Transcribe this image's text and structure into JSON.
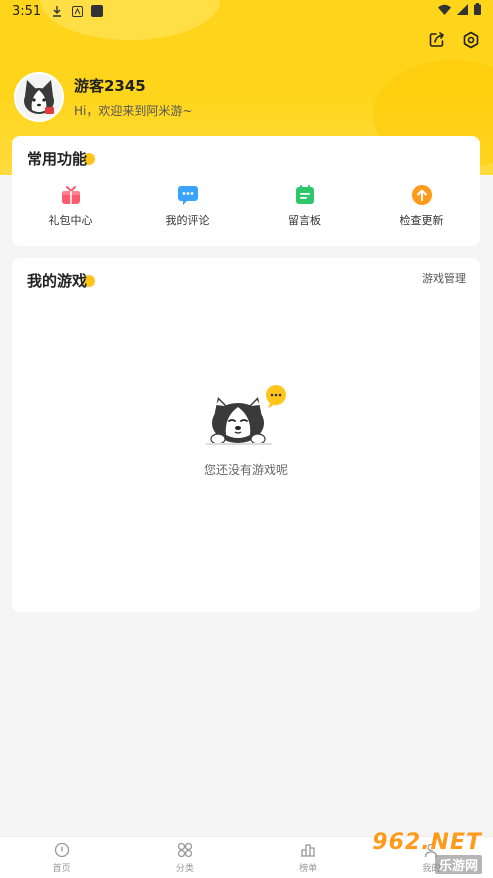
{
  "statusbar": {
    "time": "3:51"
  },
  "profile": {
    "username": "游客2345",
    "greeting": "Hi，欢迎来到阿米游~"
  },
  "functions": {
    "title": "常用功能",
    "items": [
      {
        "label": "礼包中心",
        "icon": "gift-icon",
        "color": "#ff5b6e"
      },
      {
        "label": "我的评论",
        "icon": "comment-icon",
        "color": "#3aa3ff"
      },
      {
        "label": "留言板",
        "icon": "message-board-icon",
        "color": "#2ec66b"
      },
      {
        "label": "检查更新",
        "icon": "update-icon",
        "color": "#ff9a1a"
      }
    ]
  },
  "games": {
    "title": "我的游戏",
    "manage_label": "游戏管理",
    "empty_message": "您还没有游戏呢"
  },
  "tabs": [
    {
      "label": "首页",
      "icon": "home-icon"
    },
    {
      "label": "分类",
      "icon": "category-icon"
    },
    {
      "label": "榜单",
      "icon": "ranking-icon"
    },
    {
      "label": "我的",
      "icon": "me-icon"
    }
  ],
  "watermark": {
    "line1": "962.NET",
    "line2": "乐游网"
  },
  "colors": {
    "accent": "#ffd51c",
    "title_dot": "#ffc51a"
  }
}
